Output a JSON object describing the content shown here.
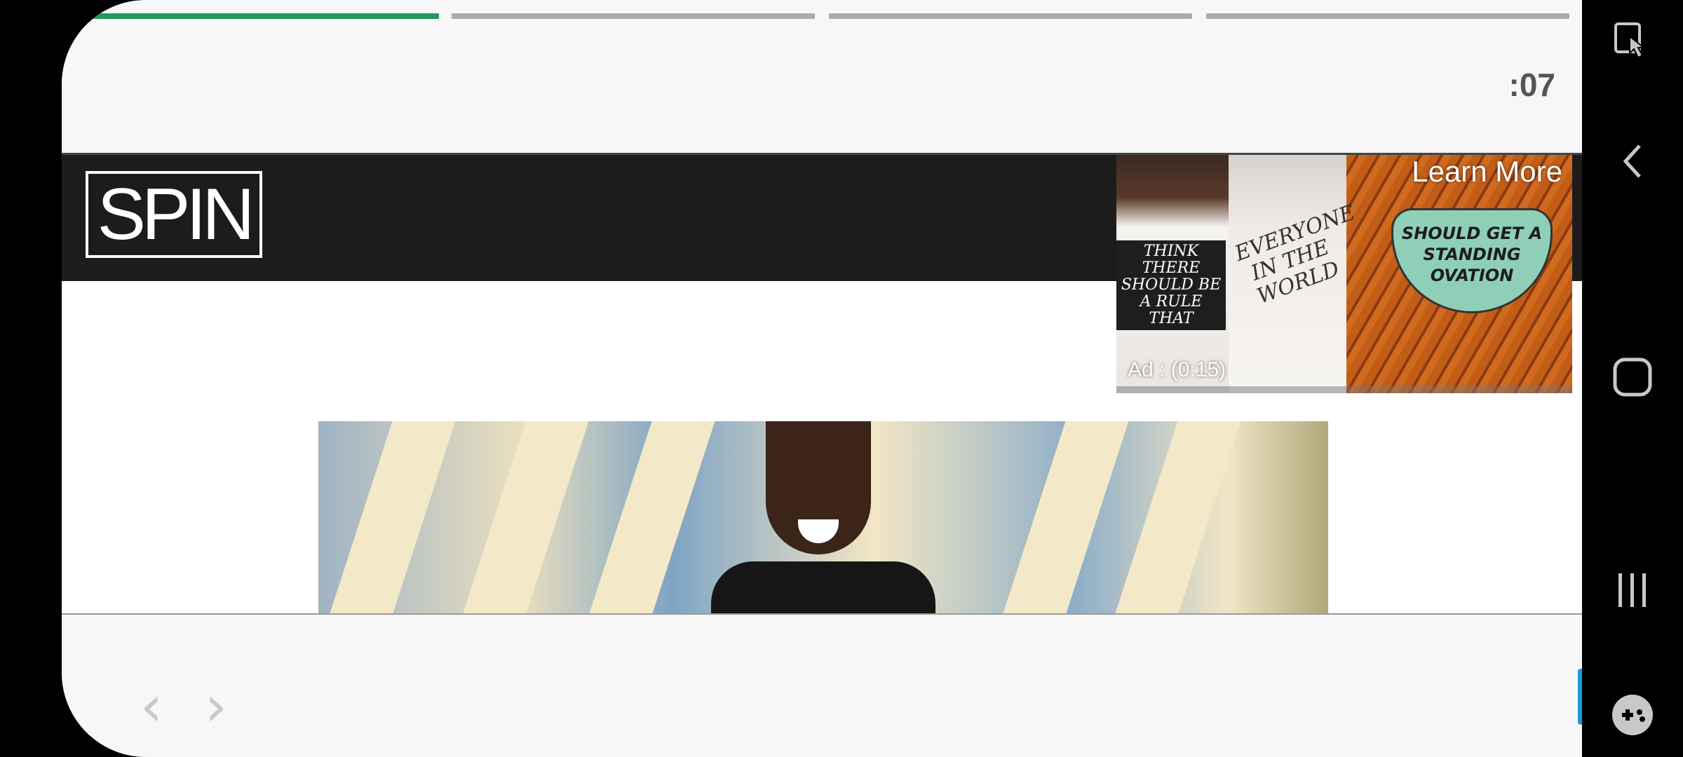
{
  "story": {
    "progress": [
      1,
      0,
      0,
      0
    ],
    "timer": ":07"
  },
  "site": {
    "logo_text": "SPIN"
  },
  "ad": {
    "cta": "Learn More",
    "label": "Ad : (0:15)",
    "shirt1_text": "THINK THERE SHOULD BE A RULE THAT",
    "shirt2_text": "EVERYONE IN THE WORLD",
    "badge_text": "SHOULD GET A STANDING OVATION"
  },
  "nav": {
    "back_icon": "chevron-left-icon",
    "forward_icon": "chevron-right-icon",
    "brand_icon": "brand-play-icon"
  },
  "system_bar": {
    "icons": [
      "touch-icon",
      "back-icon",
      "home-icon",
      "recents-icon",
      "game-icon"
    ]
  },
  "colors": {
    "progress_active": "#1e9a5a",
    "progress_inactive": "#ababab",
    "header_bg": "#1c1c1c",
    "brand": "#1a9ad6"
  }
}
